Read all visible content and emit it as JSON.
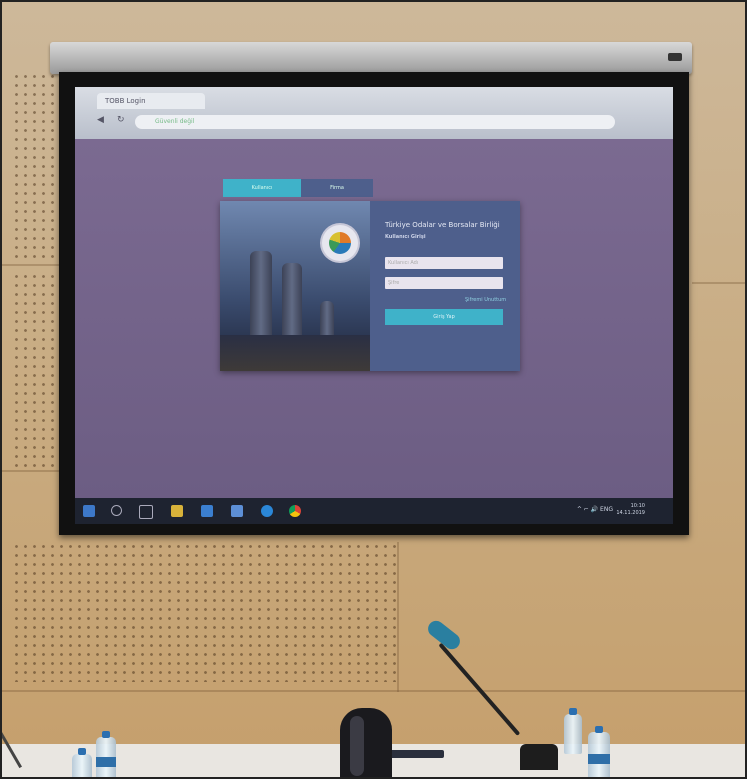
{
  "scene": {
    "description_colors": {
      "wall": "#c9ad84",
      "screen_bezel": "#111111",
      "projected_page": "#6c5d83",
      "login_button": "#3fb2c9",
      "mic_head": "#2a7fa0"
    }
  },
  "browser": {
    "tab_title": "TOBB Login",
    "address": "Güvenli değil"
  },
  "login": {
    "tab_active": "Kullanıcı",
    "tab_other": "Firma",
    "title": "Türkiye Odalar ve Borsalar Birliği",
    "subtitle": "Kullanıcı Girişi",
    "username_placeholder": "Kullanıcı Adı",
    "password_placeholder": "Şifre",
    "forgot": "Şifremi Unuttum",
    "button": "Giriş Yap"
  },
  "taskbar": {
    "tray": "^ ⌐ 🔊 ENG",
    "time": "10:10",
    "date": "14.11.2019"
  }
}
